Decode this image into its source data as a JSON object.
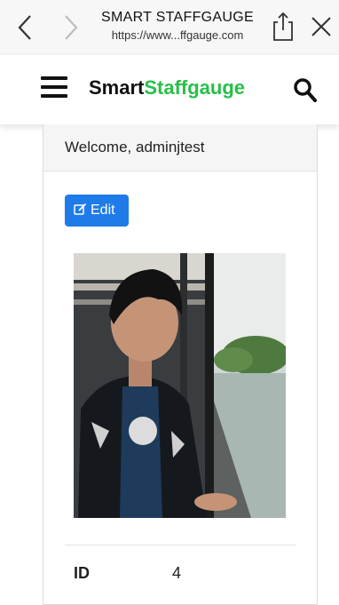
{
  "browser": {
    "site_title": "SMART STAFFGAUGE",
    "url": "https://www...ffgauge.com"
  },
  "header": {
    "brand_part1": "Smart",
    "brand_part2": "Staffgauge",
    "brand_colors": {
      "primary": "#111111",
      "accent": "#27c04a"
    }
  },
  "card": {
    "welcome_text": "Welcome, adminjtest",
    "edit_label": "Edit",
    "edit_color": "#1f7be8",
    "fields": [
      {
        "label": "ID",
        "value": "4"
      }
    ]
  },
  "icons": {
    "back": "chevron-left-icon",
    "forward": "chevron-right-icon",
    "share": "share-icon",
    "close": "close-icon",
    "menu": "hamburger-menu-icon",
    "search": "search-icon",
    "edit": "edit-icon"
  }
}
